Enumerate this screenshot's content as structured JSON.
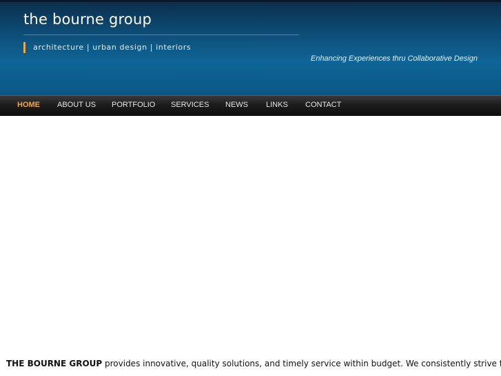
{
  "header": {
    "title": "the bourne group",
    "tagline": "architecture | urban design | interiors",
    "slogan": "Enhancing Experiences thru Collaborative Design"
  },
  "nav": {
    "items": [
      {
        "label": "HOME",
        "active": true
      },
      {
        "label": "ABOUT US",
        "active": false
      },
      {
        "label": "PORTFOLIO",
        "active": false
      },
      {
        "label": "SERVICES",
        "active": false
      },
      {
        "label": "NEWS",
        "active": false
      },
      {
        "label": "LINKS",
        "active": false
      },
      {
        "label": "CONTACT",
        "active": false
      }
    ]
  },
  "content": {
    "intro_brand": "THE BOURNE GROUP",
    "intro_text": " provides innovative, quality solutions, and timely service within budget.  We consistently  strive for"
  },
  "colors": {
    "header_blue": "#0e6596",
    "nav_dark": "#1c1c1c",
    "accent_orange": "#f2a93b",
    "text_light": "#e8e8e8"
  }
}
